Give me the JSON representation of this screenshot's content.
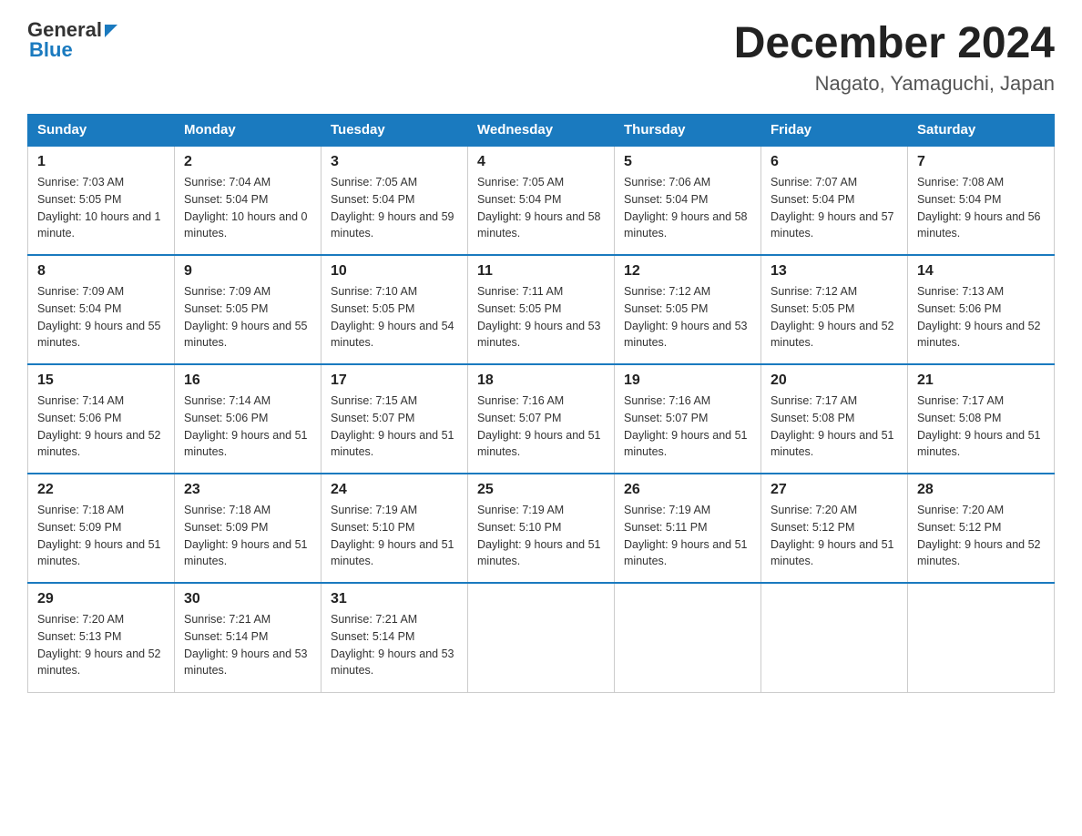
{
  "header": {
    "logo_general": "General",
    "logo_blue": "Blue",
    "title": "December 2024",
    "subtitle": "Nagato, Yamaguchi, Japan"
  },
  "days_of_week": [
    "Sunday",
    "Monday",
    "Tuesday",
    "Wednesday",
    "Thursday",
    "Friday",
    "Saturday"
  ],
  "weeks": [
    [
      {
        "day": "1",
        "sunrise": "7:03 AM",
        "sunset": "5:05 PM",
        "daylight": "10 hours and 1 minute."
      },
      {
        "day": "2",
        "sunrise": "7:04 AM",
        "sunset": "5:04 PM",
        "daylight": "10 hours and 0 minutes."
      },
      {
        "day": "3",
        "sunrise": "7:05 AM",
        "sunset": "5:04 PM",
        "daylight": "9 hours and 59 minutes."
      },
      {
        "day": "4",
        "sunrise": "7:05 AM",
        "sunset": "5:04 PM",
        "daylight": "9 hours and 58 minutes."
      },
      {
        "day": "5",
        "sunrise": "7:06 AM",
        "sunset": "5:04 PM",
        "daylight": "9 hours and 58 minutes."
      },
      {
        "day": "6",
        "sunrise": "7:07 AM",
        "sunset": "5:04 PM",
        "daylight": "9 hours and 57 minutes."
      },
      {
        "day": "7",
        "sunrise": "7:08 AM",
        "sunset": "5:04 PM",
        "daylight": "9 hours and 56 minutes."
      }
    ],
    [
      {
        "day": "8",
        "sunrise": "7:09 AM",
        "sunset": "5:04 PM",
        "daylight": "9 hours and 55 minutes."
      },
      {
        "day": "9",
        "sunrise": "7:09 AM",
        "sunset": "5:05 PM",
        "daylight": "9 hours and 55 minutes."
      },
      {
        "day": "10",
        "sunrise": "7:10 AM",
        "sunset": "5:05 PM",
        "daylight": "9 hours and 54 minutes."
      },
      {
        "day": "11",
        "sunrise": "7:11 AM",
        "sunset": "5:05 PM",
        "daylight": "9 hours and 53 minutes."
      },
      {
        "day": "12",
        "sunrise": "7:12 AM",
        "sunset": "5:05 PM",
        "daylight": "9 hours and 53 minutes."
      },
      {
        "day": "13",
        "sunrise": "7:12 AM",
        "sunset": "5:05 PM",
        "daylight": "9 hours and 52 minutes."
      },
      {
        "day": "14",
        "sunrise": "7:13 AM",
        "sunset": "5:06 PM",
        "daylight": "9 hours and 52 minutes."
      }
    ],
    [
      {
        "day": "15",
        "sunrise": "7:14 AM",
        "sunset": "5:06 PM",
        "daylight": "9 hours and 52 minutes."
      },
      {
        "day": "16",
        "sunrise": "7:14 AM",
        "sunset": "5:06 PM",
        "daylight": "9 hours and 51 minutes."
      },
      {
        "day": "17",
        "sunrise": "7:15 AM",
        "sunset": "5:07 PM",
        "daylight": "9 hours and 51 minutes."
      },
      {
        "day": "18",
        "sunrise": "7:16 AM",
        "sunset": "5:07 PM",
        "daylight": "9 hours and 51 minutes."
      },
      {
        "day": "19",
        "sunrise": "7:16 AM",
        "sunset": "5:07 PM",
        "daylight": "9 hours and 51 minutes."
      },
      {
        "day": "20",
        "sunrise": "7:17 AM",
        "sunset": "5:08 PM",
        "daylight": "9 hours and 51 minutes."
      },
      {
        "day": "21",
        "sunrise": "7:17 AM",
        "sunset": "5:08 PM",
        "daylight": "9 hours and 51 minutes."
      }
    ],
    [
      {
        "day": "22",
        "sunrise": "7:18 AM",
        "sunset": "5:09 PM",
        "daylight": "9 hours and 51 minutes."
      },
      {
        "day": "23",
        "sunrise": "7:18 AM",
        "sunset": "5:09 PM",
        "daylight": "9 hours and 51 minutes."
      },
      {
        "day": "24",
        "sunrise": "7:19 AM",
        "sunset": "5:10 PM",
        "daylight": "9 hours and 51 minutes."
      },
      {
        "day": "25",
        "sunrise": "7:19 AM",
        "sunset": "5:10 PM",
        "daylight": "9 hours and 51 minutes."
      },
      {
        "day": "26",
        "sunrise": "7:19 AM",
        "sunset": "5:11 PM",
        "daylight": "9 hours and 51 minutes."
      },
      {
        "day": "27",
        "sunrise": "7:20 AM",
        "sunset": "5:12 PM",
        "daylight": "9 hours and 51 minutes."
      },
      {
        "day": "28",
        "sunrise": "7:20 AM",
        "sunset": "5:12 PM",
        "daylight": "9 hours and 52 minutes."
      }
    ],
    [
      {
        "day": "29",
        "sunrise": "7:20 AM",
        "sunset": "5:13 PM",
        "daylight": "9 hours and 52 minutes."
      },
      {
        "day": "30",
        "sunrise": "7:21 AM",
        "sunset": "5:14 PM",
        "daylight": "9 hours and 53 minutes."
      },
      {
        "day": "31",
        "sunrise": "7:21 AM",
        "sunset": "5:14 PM",
        "daylight": "9 hours and 53 minutes."
      },
      null,
      null,
      null,
      null
    ]
  ],
  "labels": {
    "sunrise_prefix": "Sunrise: ",
    "sunset_prefix": "Sunset: ",
    "daylight_prefix": "Daylight: "
  }
}
